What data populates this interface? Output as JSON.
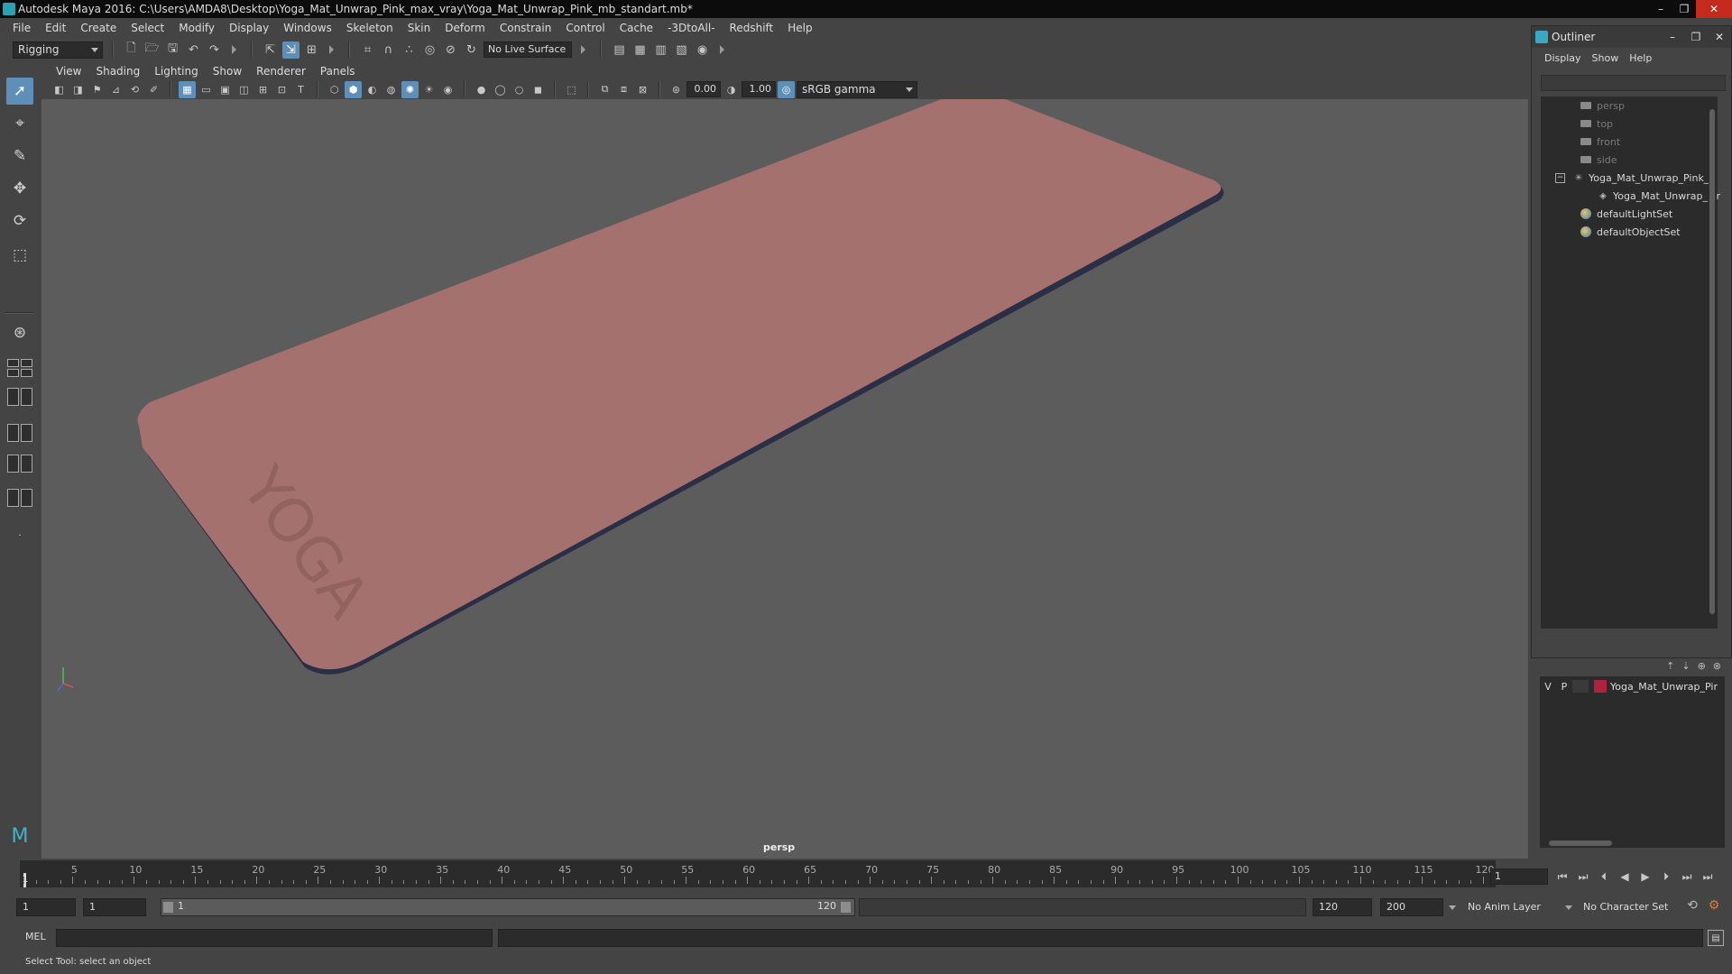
{
  "window": {
    "title": "Autodesk Maya 2016: C:\\Users\\AMDA8\\Desktop\\Yoga_Mat_Unwrap_Pink_max_vray\\Yoga_Mat_Unwrap_Pink_mb_standart.mb*",
    "minimize": "–",
    "maximize": "❐",
    "close": "✕"
  },
  "menubar": [
    "File",
    "Edit",
    "Create",
    "Select",
    "Modify",
    "Display",
    "Windows",
    "Skeleton",
    "Skin",
    "Deform",
    "Constrain",
    "Control",
    "Cache",
    "-3DtoAll-",
    "Redshift",
    "Help"
  ],
  "statusline": {
    "menuset": "Rigging",
    "live_surface": "No Live Surface"
  },
  "panel": {
    "menus": [
      "View",
      "Shading",
      "Lighting",
      "Show",
      "Renderer",
      "Panels"
    ],
    "exposure": "0.00",
    "gamma": "1.00",
    "color_space": "sRGB gamma",
    "camera": "persp",
    "model_text": "YOGA"
  },
  "outliner": {
    "title": "Outliner",
    "menus": [
      "Display",
      "Show",
      "Help"
    ],
    "items": [
      {
        "label": "persp",
        "type": "camera",
        "dim": true
      },
      {
        "label": "top",
        "type": "camera",
        "dim": true
      },
      {
        "label": "front",
        "type": "camera",
        "dim": true
      },
      {
        "label": "side",
        "type": "camera",
        "dim": true
      },
      {
        "label": "Yoga_Mat_Unwrap_Pink_n",
        "type": "group",
        "dim": false
      },
      {
        "label": "Yoga_Mat_Unwrap_Pir",
        "type": "mesh",
        "dim": false
      },
      {
        "label": "defaultLightSet",
        "type": "set",
        "dim": false
      },
      {
        "label": "defaultObjectSet",
        "type": "set",
        "dim": false
      }
    ]
  },
  "layers": {
    "rows": [
      {
        "v": "V",
        "p": "P",
        "name": "Yoga_Mat_Unwrap_Pir",
        "color": "#b0213d"
      }
    ]
  },
  "timeline": {
    "ticks": [
      1,
      5,
      10,
      15,
      20,
      25,
      30,
      35,
      40,
      45,
      50,
      55,
      60,
      65,
      70,
      75,
      80,
      85,
      90,
      95,
      100,
      105,
      110,
      115,
      120
    ],
    "current_frame": "1",
    "start": 1,
    "end": 120
  },
  "range": {
    "anim_start": "1",
    "playback_start": "1",
    "range_start_label": "1",
    "range_end_label": "120",
    "playback_end": "120",
    "anim_end": "200",
    "anim_layer": "No Anim Layer",
    "character_set": "No Character Set"
  },
  "commandline": {
    "label": "MEL"
  },
  "helpline": {
    "text": "Select Tool: select an object"
  },
  "colors": {
    "mat_top": "#a5716e",
    "mat_edge": "#2b2f45",
    "viewport_bg": "#5c5c5c",
    "selection_blue": "#5d8fb8"
  }
}
